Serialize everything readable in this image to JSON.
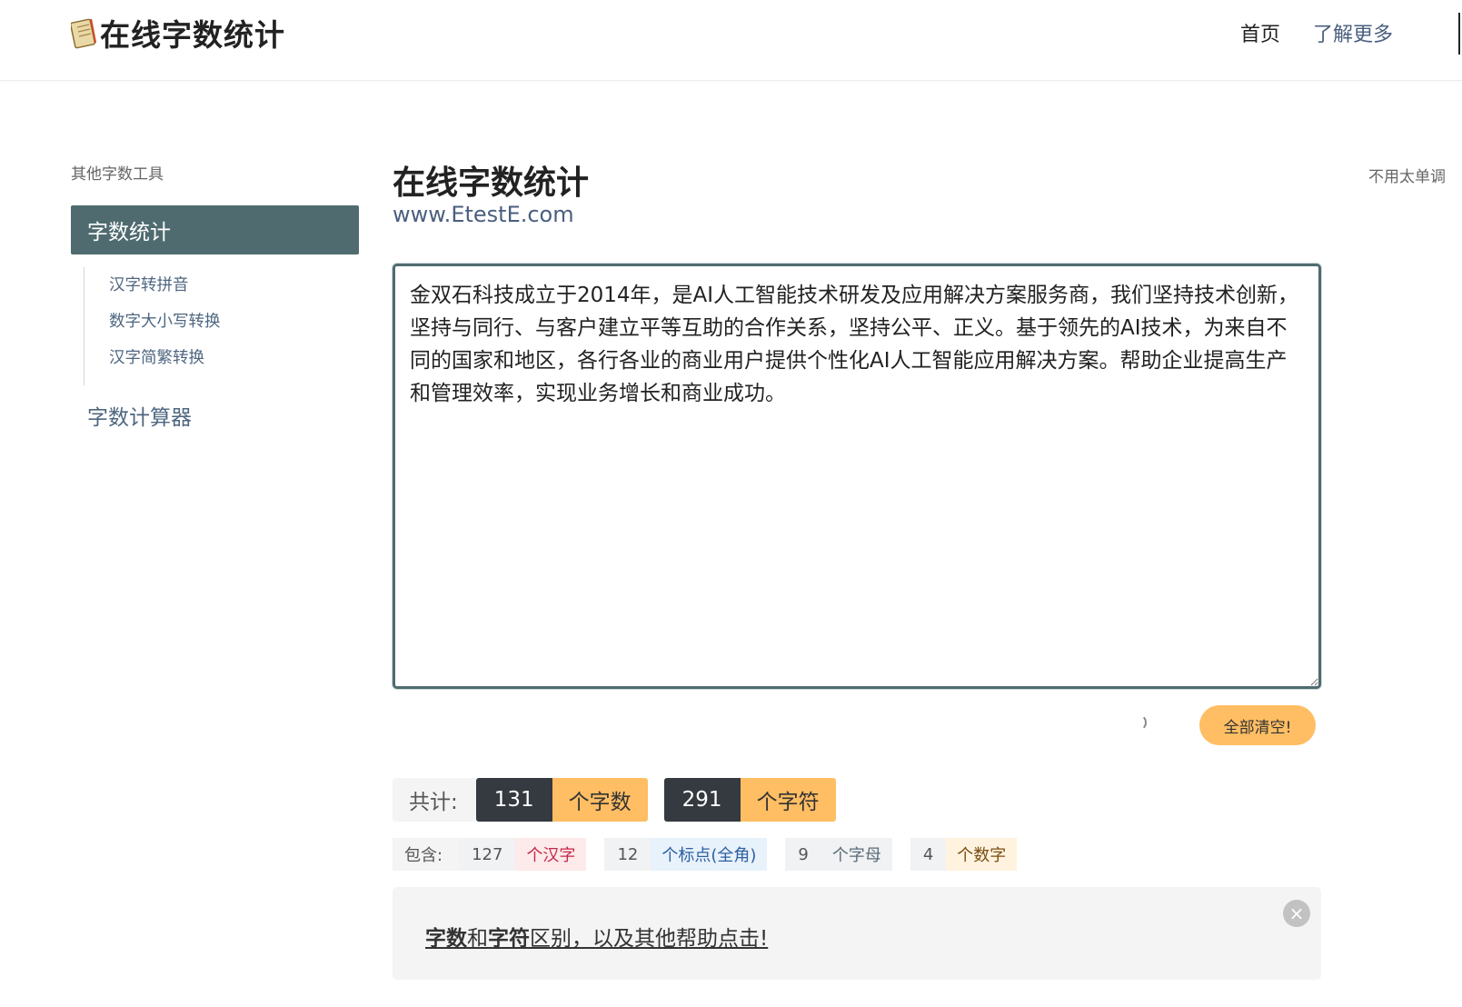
{
  "header": {
    "logo_text": "在线字数统计",
    "nav": {
      "home": "首页",
      "more": "了解更多"
    }
  },
  "sidebar": {
    "section_label": "其他字数工具",
    "active_item": "字数统计",
    "sub_items": [
      {
        "label": "汉字转拼音"
      },
      {
        "label": "数字大小写转换"
      },
      {
        "label": "汉字简繁转换"
      }
    ],
    "calc_item": "字数计算器"
  },
  "main": {
    "title": "在线字数统计",
    "subtitle": "www.EtestE.com",
    "right_hint": "不用太单调",
    "editor_text": "金双石科技成立于2014年，是AI人工智能技术研发及应用解决方案服务商，我们坚持技术创新，坚持与同行、与客户建立平等互助的合作关系，坚持公平、正义。基于领先的AI技术，为来自不同的国家和地区，各行各业的商业用户提供个性化AI人工智能应用解决方案。帮助企业提高生产和管理效率，实现业务增长和商业成功。",
    "clear_button": "全部清空!"
  },
  "totals": {
    "label": "共计:",
    "char_count": "131",
    "char_unit": "个字数",
    "symbol_count": "291",
    "symbol_unit": "个字符"
  },
  "contains": {
    "label": "包含:",
    "items": [
      {
        "num": "127",
        "unit": "个汉字",
        "color": "#c4284a"
      },
      {
        "num": "12",
        "unit": "个标点(全角)",
        "color": "#2d5fa1"
      },
      {
        "num": "9",
        "unit": "个字母",
        "color": "#5b6b78"
      },
      {
        "num": "4",
        "unit": "个数字",
        "color": "#7a4e10"
      }
    ]
  },
  "help": {
    "part1": "字数",
    "part2": "和",
    "part3": "字符",
    "part4": "区别，以及其他帮助点击!",
    "close_icon": "×"
  },
  "colors": {
    "sidebar_active": "#4f6b70",
    "accent_orange": "#ffbe63",
    "dark_badge": "#343a3f",
    "link_blue": "#4a5f7f"
  }
}
